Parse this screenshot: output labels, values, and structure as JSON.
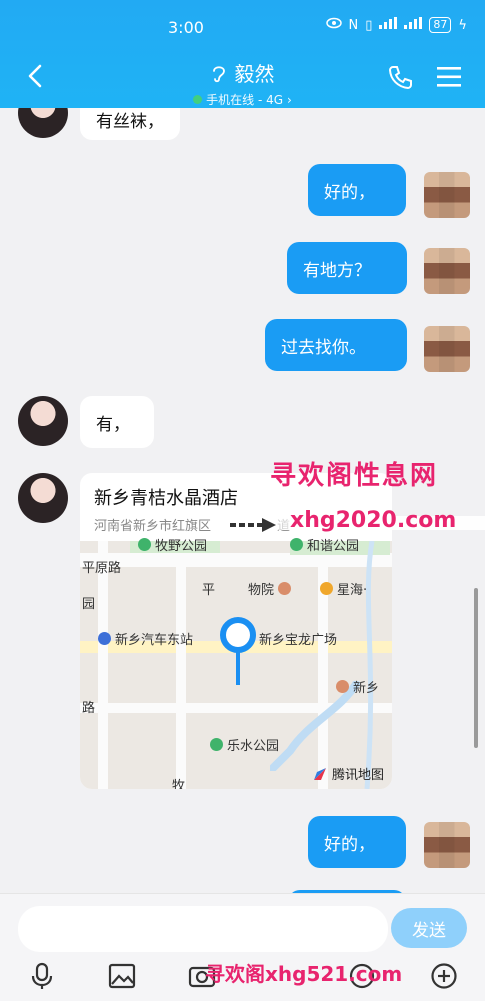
{
  "status_bar": {
    "time": "3:00",
    "battery": "87"
  },
  "header": {
    "contact_name": "毅然",
    "status_text": "手机在线 - 4G",
    "chevron": "›"
  },
  "icons": {
    "back": "back-arrow-icon",
    "phone": "phone-icon",
    "menu": "menu-icon",
    "ear": "ear-icon",
    "mic": "microphone-icon",
    "image": "image-icon",
    "camera": "camera-icon",
    "plus": "plus-icon",
    "pin": "map-pin-icon"
  },
  "messages": [
    {
      "side": "in",
      "text": "有丝袜，"
    },
    {
      "side": "out",
      "text": "好的，"
    },
    {
      "side": "out",
      "text": "有地方？"
    },
    {
      "side": "out",
      "text": "过去找你。"
    },
    {
      "side": "in",
      "text": "有，"
    },
    {
      "side": "out",
      "text": "好的，"
    }
  ],
  "location": {
    "title": "新乡青桔水晶酒店",
    "address": "河南省新乡市红旗区",
    "address_tail": "道",
    "map_labels": [
      "牧野公园",
      "和谐公园",
      "平原路",
      "园",
      "平",
      "物院",
      "星海·",
      "新乡汽车东站",
      "新乡宝龙广场",
      "新乡",
      "路",
      "乐水公园",
      "牧"
    ],
    "map_brand": "腾讯地图"
  },
  "watermarks": {
    "top": "寻欢阁性息网",
    "middle": "xhg2020.com",
    "bottom": "寻欢阁xhg521.com"
  },
  "input_bar": {
    "placeholder": "",
    "send_label": "发送"
  },
  "colors": {
    "header": "#22aaf3",
    "bubble_out": "#1a9cf4",
    "send": "#8fd0fb",
    "watermark": "#e8246e"
  }
}
